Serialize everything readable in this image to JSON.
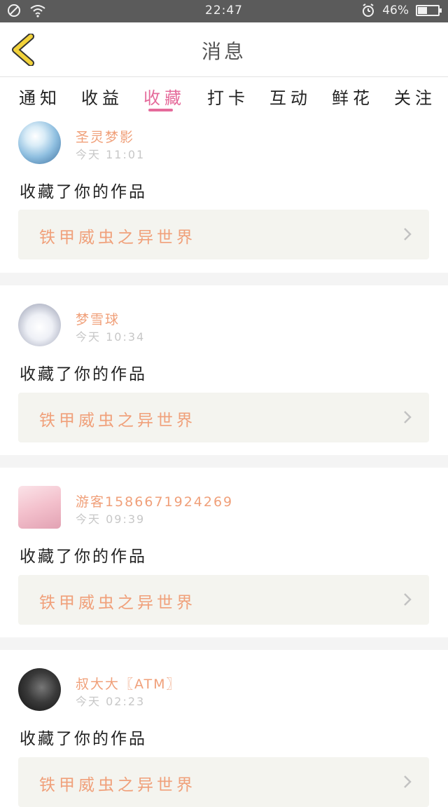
{
  "status_bar": {
    "time": "22:47",
    "battery": "46%",
    "battery_level": 0.46
  },
  "header": {
    "title": "消息"
  },
  "tabs": [
    {
      "label": "通知",
      "active": false
    },
    {
      "label": "收益",
      "active": false
    },
    {
      "label": "收藏",
      "active": true
    },
    {
      "label": "打卡",
      "active": false
    },
    {
      "label": "互动",
      "active": false
    },
    {
      "label": "鲜花",
      "active": false
    },
    {
      "label": "关注",
      "active": false
    }
  ],
  "messages": [
    {
      "username": "圣灵梦影",
      "time": "今天 11:01",
      "action": "收藏了你的作品",
      "work_title": "铁甲威虫之异世界"
    },
    {
      "username": "梦雪球",
      "time": "今天 10:34",
      "action": "收藏了你的作品",
      "work_title": "铁甲威虫之异世界"
    },
    {
      "username": "游客15866719242​69",
      "time": "今天 09:39",
      "action": "收藏了你的作品",
      "work_title": "铁甲威虫之异世界"
    },
    {
      "username": "叔大大〖ATM〗",
      "time": "今天 02:23",
      "action": "收藏了你的作品",
      "work_title": "铁甲威虫之异世界"
    }
  ],
  "colors": {
    "accent": "#e56b9b",
    "name_orange": "#f0a07a",
    "back_yellow": "#f2d23a"
  },
  "icons": [
    "no-disturb-icon",
    "wifi-icon",
    "alarm-icon",
    "battery-icon",
    "back-arrow-icon",
    "chevron-right-icon"
  ]
}
